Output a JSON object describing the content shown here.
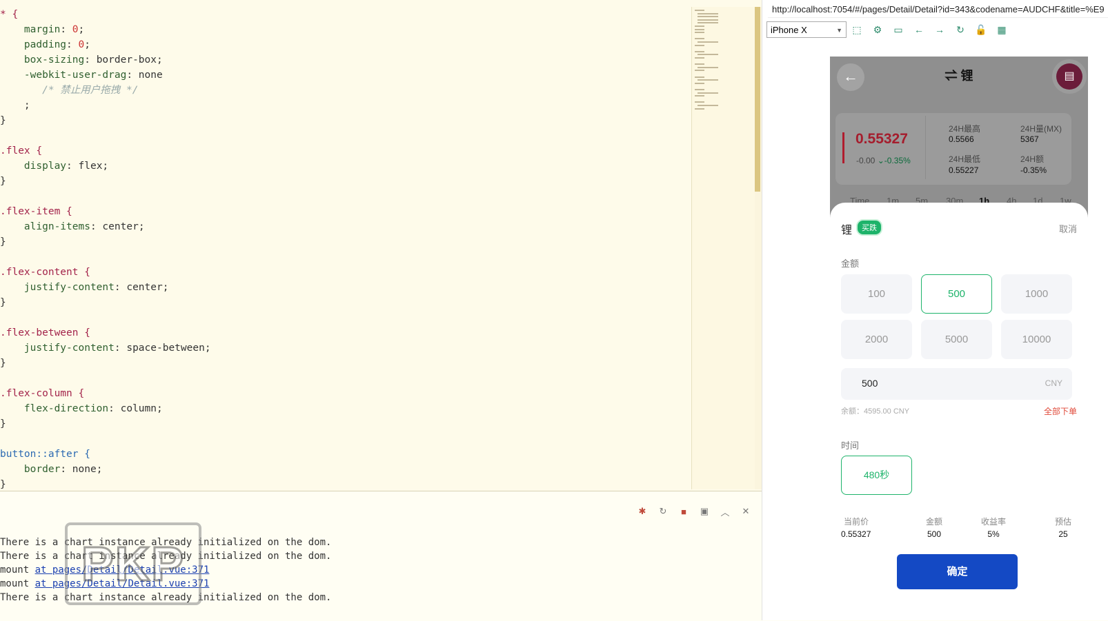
{
  "editor": {
    "lines": [
      {
        "sel": "* {"
      },
      {
        "prop": "margin",
        "val": "0",
        "num": true
      },
      {
        "prop": "padding",
        "val": "0",
        "num": true
      },
      {
        "prop": "box-sizing",
        "val": "border-box"
      },
      {
        "prop": "-webkit-user-drag",
        "val": "none"
      },
      {
        "comment": "/* 禁止用户拖拽 */"
      },
      {
        "semi": ";"
      },
      {
        "close": "}"
      },
      {
        "blank": ""
      },
      {
        "sel": ".flex {"
      },
      {
        "prop": "display",
        "val": "flex"
      },
      {
        "close": "}"
      },
      {
        "blank": ""
      },
      {
        "sel": ".flex-item {"
      },
      {
        "prop": "align-items",
        "val": "center"
      },
      {
        "close": "}"
      },
      {
        "blank": ""
      },
      {
        "sel": ".flex-content {"
      },
      {
        "prop": "justify-content",
        "val": "center"
      },
      {
        "close": "}"
      },
      {
        "blank": ""
      },
      {
        "sel": ".flex-between {"
      },
      {
        "prop": "justify-content",
        "val": "space-between"
      },
      {
        "close": "}"
      },
      {
        "blank": ""
      },
      {
        "sel": ".flex-column {"
      },
      {
        "prop": "flex-direction",
        "val": "column"
      },
      {
        "close": "}"
      },
      {
        "blank": ""
      },
      {
        "sel": "button::after {",
        "kw": true
      },
      {
        "prop": "border",
        "val": "none"
      },
      {
        "close": "}"
      }
    ]
  },
  "console": {
    "lines": [
      {
        "text": "There is a chart instance already initialized on the dom."
      },
      {
        "text": "There is a chart instance already initialized on the dom."
      },
      {
        "text": "mount ",
        "link": "at pages/Detail/Detail.vue:371"
      },
      {
        "text": "mount ",
        "link": "at pages/Detail/Detail.vue:371"
      },
      {
        "text": "There is a chart instance already initialized on the dom."
      }
    ],
    "watermark": "PKP"
  },
  "browser": {
    "url": "http://localhost:7054/#/pages/Detail/Detail?id=343&codename=AUDCHF&title=%E9",
    "device": "iPhone X"
  },
  "app": {
    "title": "⇌ 锂",
    "price": "0.55327",
    "change": "-0.00",
    "change_pct": "-0.35%",
    "stats": {
      "high_label": "24H最高",
      "high": "0.5566",
      "vol_label": "24H量(MX)",
      "vol": "5367",
      "low_label": "24H最低",
      "low": "0.55227",
      "amt_label": "24H额",
      "amt": "-0.35%"
    },
    "timeframes": [
      "Time",
      "1m",
      "5m",
      "30m",
      "1h",
      "4h",
      "1d",
      "1w"
    ],
    "active_timeframe": "1h",
    "sheet": {
      "symbol": "锂",
      "badge": "买跌",
      "cancel": "取消",
      "amount_label": "金额",
      "amounts": [
        "100",
        "500",
        "1000",
        "2000",
        "5000",
        "10000"
      ],
      "selected_amount": "500",
      "input_value": "500",
      "input_unit": "CNY",
      "balance": "余额：4595.00 CNY",
      "all_in": "全部下单",
      "time_label": "时间",
      "time_option": "480秒",
      "summary": [
        {
          "label": "当前价",
          "value": "0.55327"
        },
        {
          "label": "金额",
          "value": "500"
        },
        {
          "label": "收益率",
          "value": "5%"
        },
        {
          "label": "预估",
          "value": "25"
        }
      ],
      "confirm": "确定"
    }
  },
  "colors": {
    "accent_green": "#1db36a",
    "confirm_blue": "#1449c4",
    "price_red": "#a51d2d",
    "link_red": "#e04a3a"
  },
  "icons": [
    "back-arrow-icon",
    "menu-book-icon",
    "chevron-down-icon",
    "bug-icon",
    "restart-icon",
    "stop-icon",
    "screenshot-icon",
    "chevron-up-icon",
    "clear-console-icon",
    "inspect-icon",
    "settings-icon",
    "terminal-icon",
    "arrow-left-icon",
    "arrow-right-icon",
    "refresh-icon",
    "lock-icon",
    "qr-code-icon"
  ]
}
